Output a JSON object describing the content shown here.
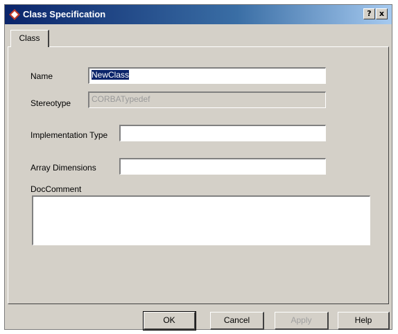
{
  "window": {
    "title": "Class Specification",
    "help_label": "?",
    "close_label": "x"
  },
  "tabs": [
    {
      "label": "Class",
      "selected": true
    }
  ],
  "form": {
    "name_label": "Name",
    "name_value": "NewClass",
    "stereotype_label": "Stereotype",
    "stereotype_value": "CORBATypedef",
    "implementation_type_label": "Implementation Type",
    "implementation_type_value": "",
    "array_dimensions_label": "Array Dimensions",
    "array_dimensions_value": "",
    "doc_comment_label": "DocComment",
    "doc_comment_value": ""
  },
  "buttons": {
    "ok": "OK",
    "cancel": "Cancel",
    "apply": "Apply",
    "help": "Help"
  }
}
